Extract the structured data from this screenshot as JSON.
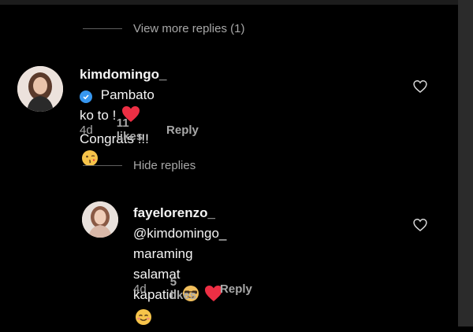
{
  "view_more_replies": "View more replies (1)",
  "hide_replies": "Hide replies",
  "comments": [
    {
      "username": "kimdomingo_",
      "verified": true,
      "line1": "Pambato ko to !",
      "line2": "Congrats !!!",
      "time": "4d",
      "likes": "11 likes",
      "reply": "Reply",
      "icons": [
        "red-heart-emoji",
        "kissing-face-emoji",
        "verified-badge-icon",
        "heart-outline-icon"
      ]
    },
    {
      "username": "fayelorenzo_",
      "mention": "@kimdomingo_",
      "line2": "maraming salamat kapatid",
      "time": "4d",
      "likes": "5 likes",
      "reply": "Reply",
      "icons": [
        "sunglasses-face-emoji",
        "red-heart-emoji",
        "smiling-hearts-face-emoji",
        "heart-outline-icon"
      ]
    }
  ],
  "colors": {
    "background": "#000000",
    "text": "#f5f5f5",
    "muted": "#a8a8a8",
    "verified": "#3797f0",
    "heart": "#ed2f44"
  }
}
